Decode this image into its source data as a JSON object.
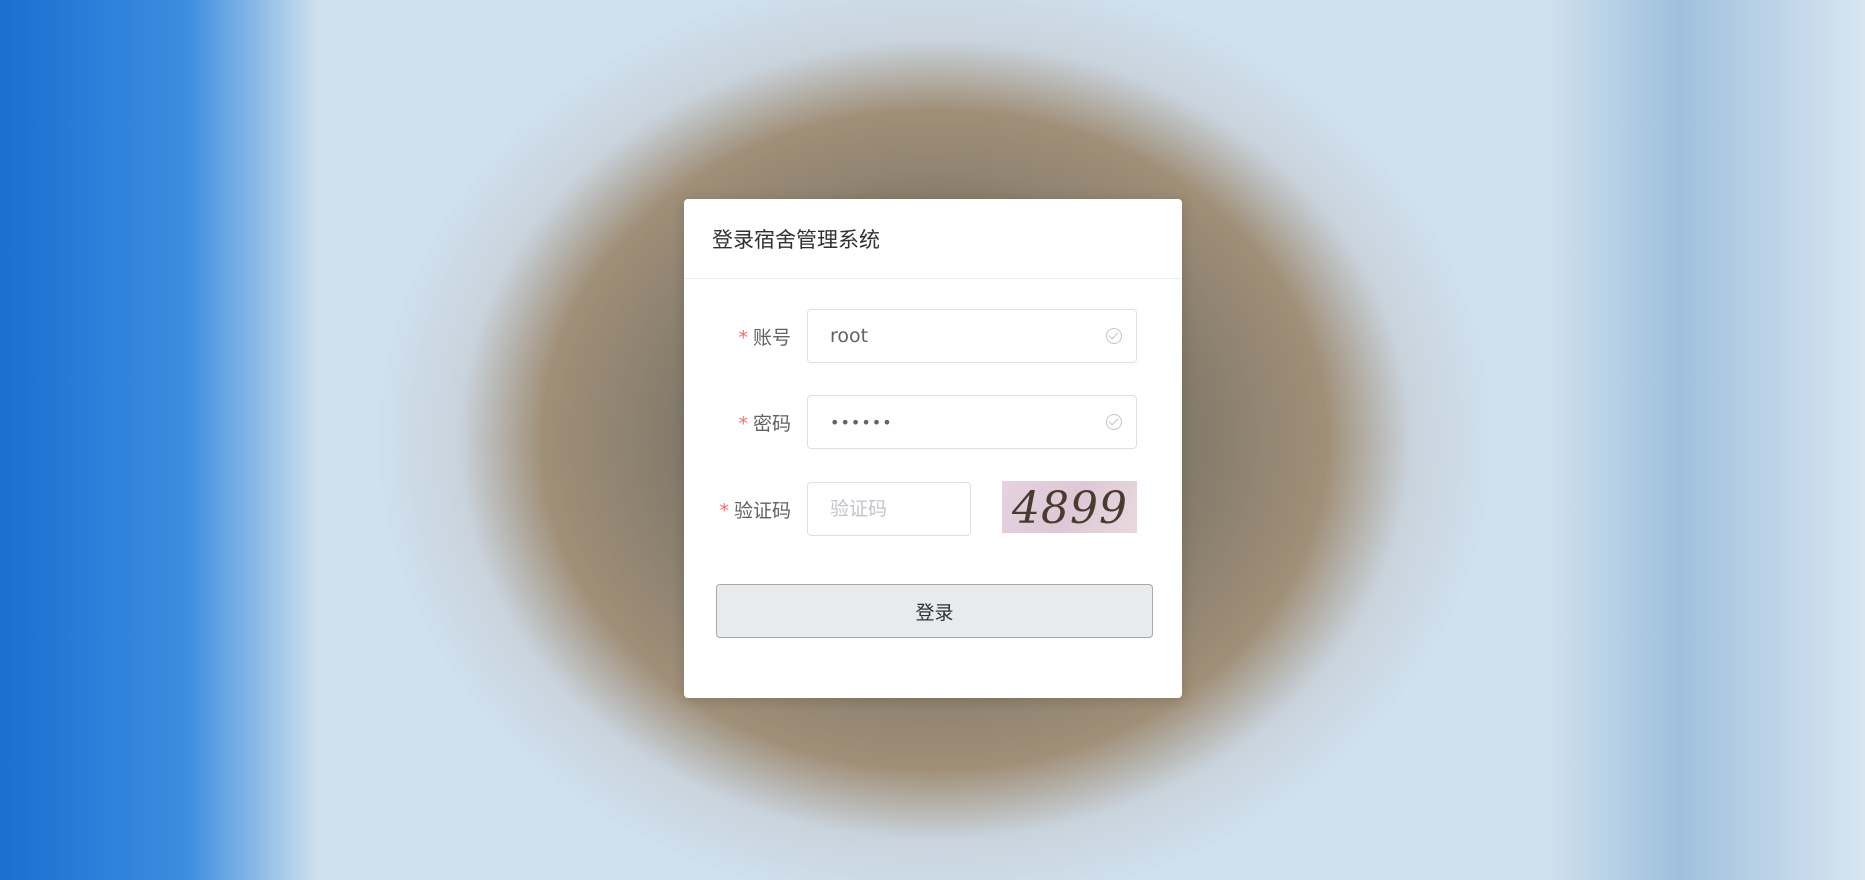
{
  "login": {
    "title": "登录宿舍管理系统",
    "required_mark": "*",
    "account": {
      "label": "账号",
      "value": "root"
    },
    "password": {
      "label": "密码",
      "value": "••••••"
    },
    "captcha": {
      "label": "验证码",
      "placeholder": "验证码",
      "value": "",
      "image_text": "4899"
    },
    "submit_label": "登录"
  }
}
